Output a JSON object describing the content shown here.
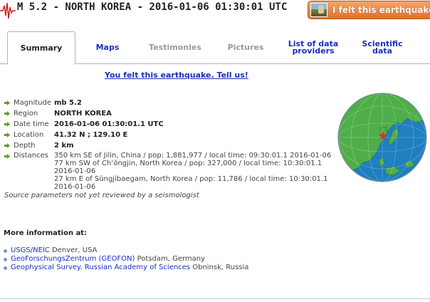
{
  "header": {
    "title": "M 5.2 - NORTH KOREA - 2016-01-06 01:30:01 UTC",
    "felt_button": "I felt this earthquake"
  },
  "tabs": [
    {
      "label": "Summary",
      "state": "active"
    },
    {
      "label": "Maps",
      "state": "link"
    },
    {
      "label": "Testimonies",
      "state": "dim"
    },
    {
      "label": "Pictures",
      "state": "dim"
    },
    {
      "label": "List of data providers",
      "state": "link"
    },
    {
      "label": "Scientific data",
      "state": "link"
    }
  ],
  "felt_link": "You felt this earthquake. Tell us!",
  "details": {
    "magnitude": {
      "label": "Magnitude",
      "value": "mb 5.2"
    },
    "region": {
      "label": "Region",
      "value": "NORTH KOREA"
    },
    "datetime": {
      "label": "Date time",
      "value": "2016-01-06 01:30:01.1 UTC"
    },
    "location": {
      "label": "Location",
      "value": "41.32 N ; 129.10 E"
    },
    "depth": {
      "label": "Depth",
      "value": "2 km"
    },
    "distances_label": "Distances",
    "distances": [
      "350 km SE of Jilin, China / pop: 1,881,977 / local time: 09:30:01.1 2016-01-06",
      "77 km SW of Ch’ŏngjin, North Korea / pop: 327,000 / local time: 10:30:01.1 2016-01-06",
      "27 km E of Sŭngjibaegam, North Korea / pop: 11,786 / local time: 10:30:01.1 2016-01-06"
    ],
    "note": "Source parameters not yet reviewed by a seismologist"
  },
  "more_info": {
    "title": "More information at:",
    "items": [
      {
        "link": "USGS/NEIC",
        "rest": " Denver, USA"
      },
      {
        "link": "GeoForschungsZentrum (GEOFON)",
        "rest": " Potsdam, Germany"
      },
      {
        "link": "Geophysical Survey. Russian Academy of Sciences",
        "rest": " Obninsk, Russia"
      }
    ]
  },
  "icons": {
    "bullet": "green-arrow-icon",
    "globe": "globe-map-icon",
    "epicenter": "star-icon"
  },
  "colors": {
    "link": "#1a2fbf",
    "felt_button": "#e0702c",
    "bullet": "#5aa02c",
    "ocean": "#1f7fc0",
    "land": "#4fae4a",
    "epicenter": "#e0302a"
  }
}
